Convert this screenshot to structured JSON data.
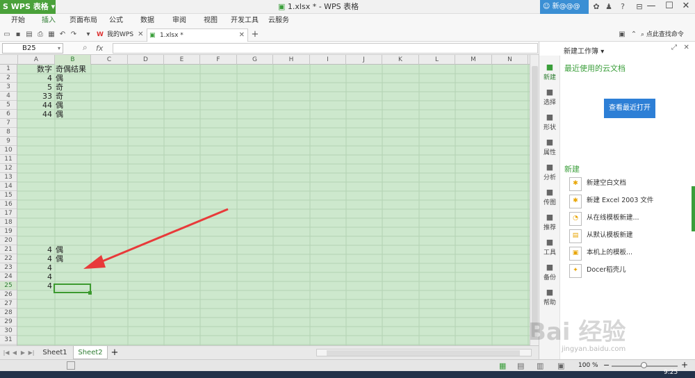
{
  "app": {
    "name": "WPS 表格",
    "title": "1.xlsx * - WPS 表格",
    "user": "新@@@"
  },
  "menu": [
    "开始",
    "插入",
    "页面布局",
    "公式",
    "数据",
    "审阅",
    "视图",
    "开发工具",
    "云服务"
  ],
  "menu_active_index": 1,
  "doc_tabs": [
    {
      "label": "我的WPS",
      "icon": "wps-logo-icon"
    },
    {
      "label": "1.xlsx *",
      "icon": "spreadsheet-file-icon"
    }
  ],
  "toolbar": {
    "command_search": "点此查找命令"
  },
  "formula_bar": {
    "name_box": "B25",
    "fx_label": "fx",
    "value": ""
  },
  "grid": {
    "columns": [
      "A",
      "B",
      "C",
      "D",
      "E",
      "F",
      "G",
      "H",
      "I",
      "J",
      "K",
      "L",
      "M",
      "N"
    ],
    "selected_column": "B",
    "row_count": 31,
    "selected_row": 25,
    "cells": [
      {
        "row": 1,
        "a": "数字",
        "b": "奇偶结果"
      },
      {
        "row": 2,
        "a": "4",
        "b": "偶"
      },
      {
        "row": 3,
        "a": "5",
        "b": "奇"
      },
      {
        "row": 4,
        "a": "33",
        "b": "奇"
      },
      {
        "row": 5,
        "a": "44",
        "b": "偶"
      },
      {
        "row": 6,
        "a": "44",
        "b": "偶"
      },
      {
        "row": 21,
        "a": "4",
        "b": "偶"
      },
      {
        "row": 22,
        "a": "4",
        "b": "偶"
      },
      {
        "row": 23,
        "a": "4",
        "b": ""
      },
      {
        "row": 24,
        "a": "4",
        "b": ""
      },
      {
        "row": 25,
        "a": "4",
        "b": ""
      }
    ],
    "selected_cell": "B25",
    "annotation": {
      "type": "red-arrow",
      "color": "#e83a3a"
    }
  },
  "sheets": {
    "tabs": [
      "Sheet1",
      "Sheet2"
    ],
    "active": "Sheet2",
    "add_label": "+"
  },
  "status": {
    "zoom": "100 %"
  },
  "clock": "9:25",
  "task_pane": {
    "title": "新建工作簿",
    "nav": [
      {
        "label": "新建",
        "icon": "new-doc-icon"
      },
      {
        "label": "选择",
        "icon": "select-icon"
      },
      {
        "label": "形状",
        "icon": "shape-icon"
      },
      {
        "label": "属性",
        "icon": "property-icon"
      },
      {
        "label": "分析",
        "icon": "analysis-icon"
      },
      {
        "label": "传图",
        "icon": "upload-image-icon"
      },
      {
        "label": "推荐",
        "icon": "recommend-icon"
      },
      {
        "label": "工具",
        "icon": "tools-icon"
      },
      {
        "label": "备份",
        "icon": "backup-icon"
      },
      {
        "label": "帮助",
        "icon": "help-icon"
      }
    ],
    "recent_title": "最近使用的云文档",
    "open_recent_button": "查看最近打开",
    "new_section_title": "新建",
    "new_items": [
      {
        "label": "新建空白文档",
        "icon": "blank-doc-icon"
      },
      {
        "label": "新建 Excel 2003 文件",
        "icon": "excel2003-doc-icon"
      },
      {
        "label": "从在线模板新建...",
        "icon": "online-template-icon"
      },
      {
        "label": "从默认模板新建",
        "icon": "default-template-icon"
      },
      {
        "label": "本机上的模板...",
        "icon": "local-template-icon"
      },
      {
        "label": "Docer稻壳儿",
        "icon": "docer-icon"
      }
    ]
  },
  "watermark": {
    "text": "Bai 经验",
    "url": "jingyan.baidu.com"
  },
  "colors": {
    "accent": "#3a9e3a",
    "grid_bg": "#cde8cd",
    "button_blue": "#2d7fd6",
    "arrow": "#e83a3a"
  }
}
